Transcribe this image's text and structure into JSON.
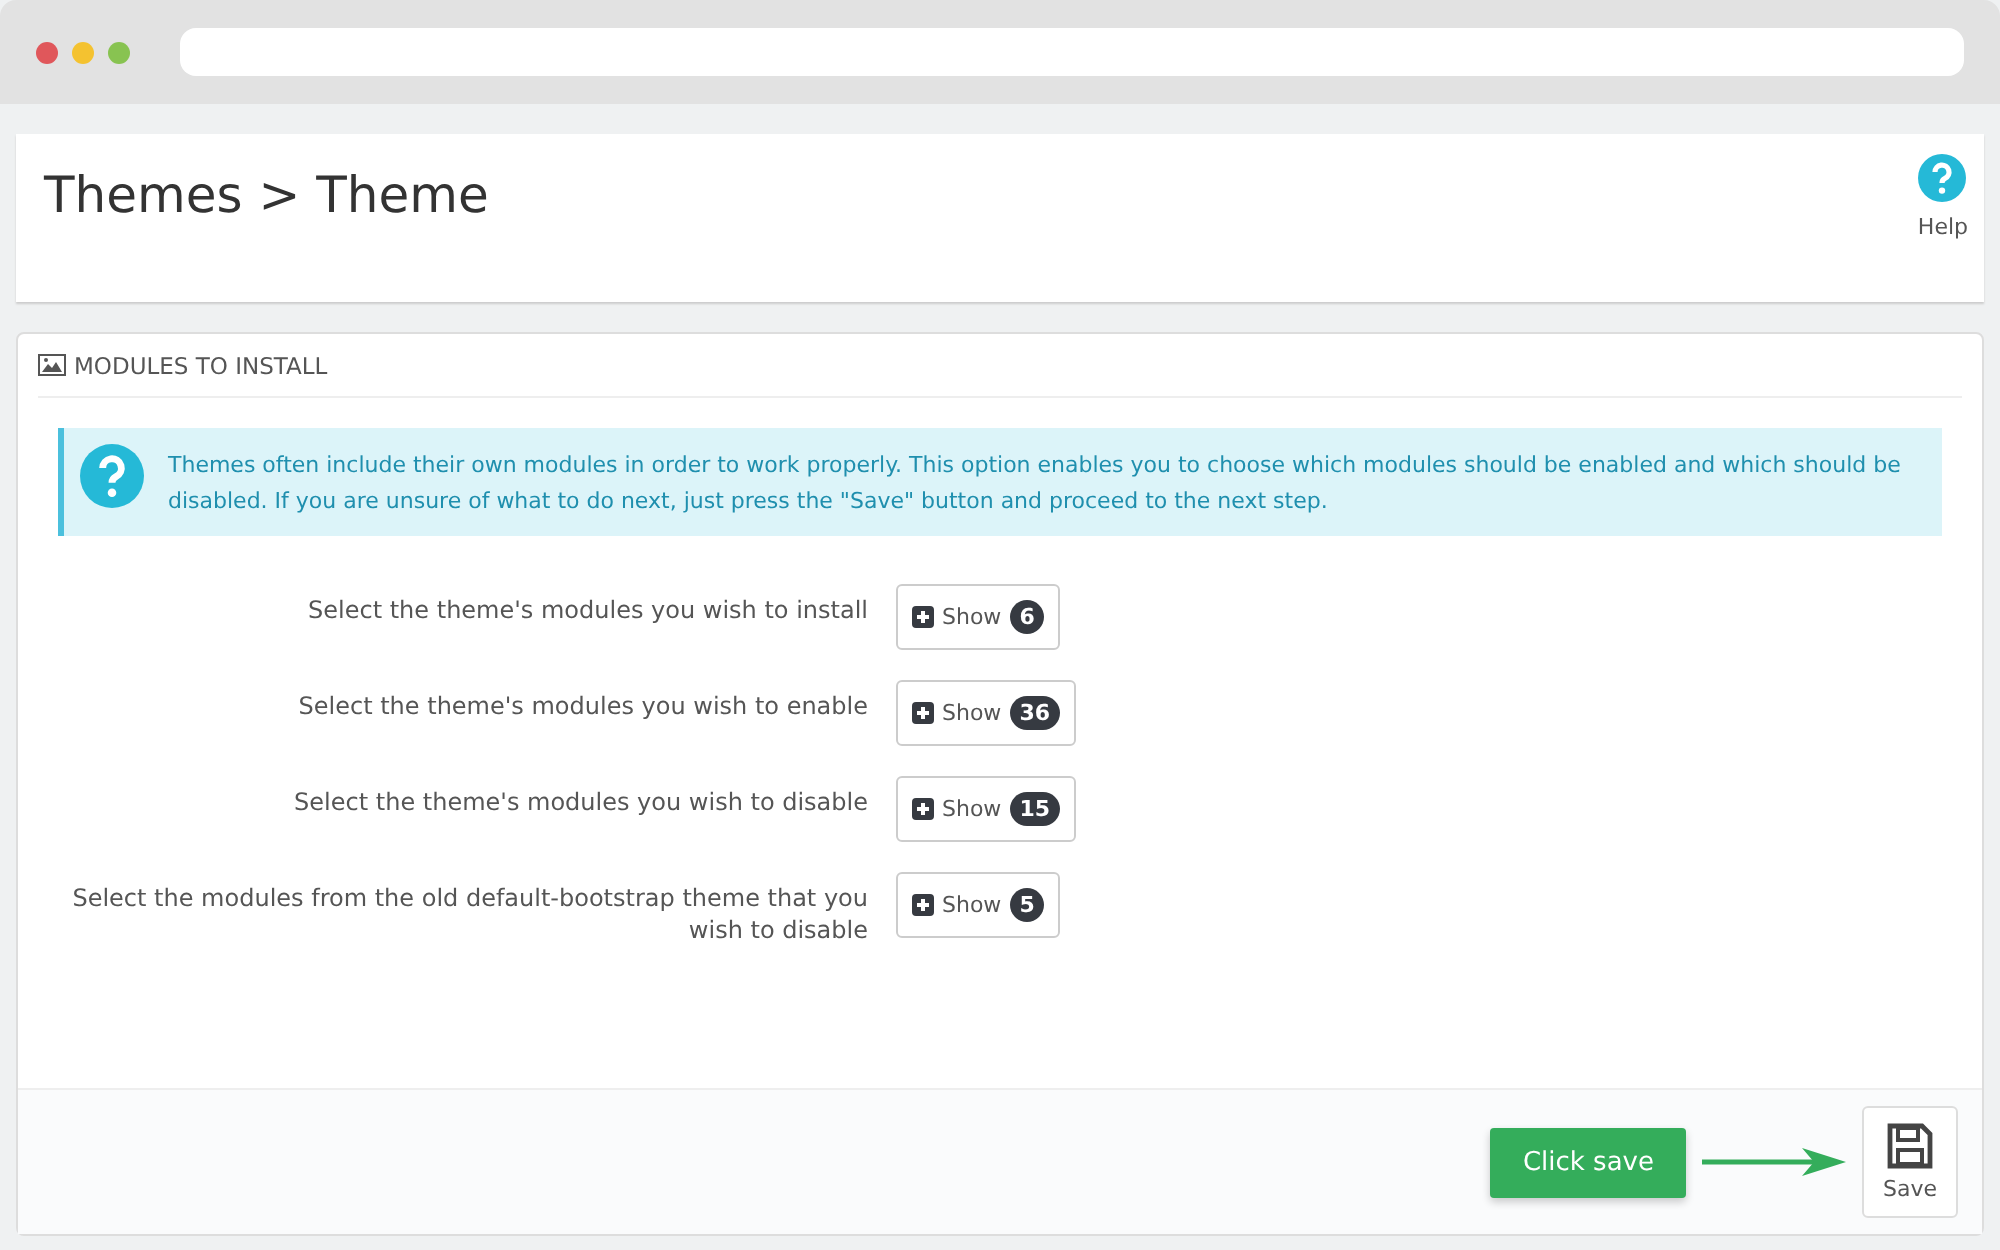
{
  "page": {
    "breadcrumb": "Themes > Theme",
    "help": "Help"
  },
  "panel": {
    "title": "MODULES TO INSTALL",
    "info": "Themes often include their own modules in order to work properly. This option enables you to choose which modules should be enabled and which should be disabled. If you are unsure of what to do next, just press the \"Save\" button and proceed to the next step.",
    "rows": [
      {
        "label": "Select the theme's modules you wish to install",
        "button": "Show",
        "count": "6"
      },
      {
        "label": "Select the theme's modules you wish to enable",
        "button": "Show",
        "count": "36"
      },
      {
        "label": "Select the theme's modules you wish to disable",
        "button": "Show",
        "count": "15"
      },
      {
        "label": "Select the modules from the old default-bootstrap theme that you wish to disable",
        "button": "Show",
        "count": "5"
      }
    ],
    "save": "Save"
  },
  "callout": "Click save"
}
